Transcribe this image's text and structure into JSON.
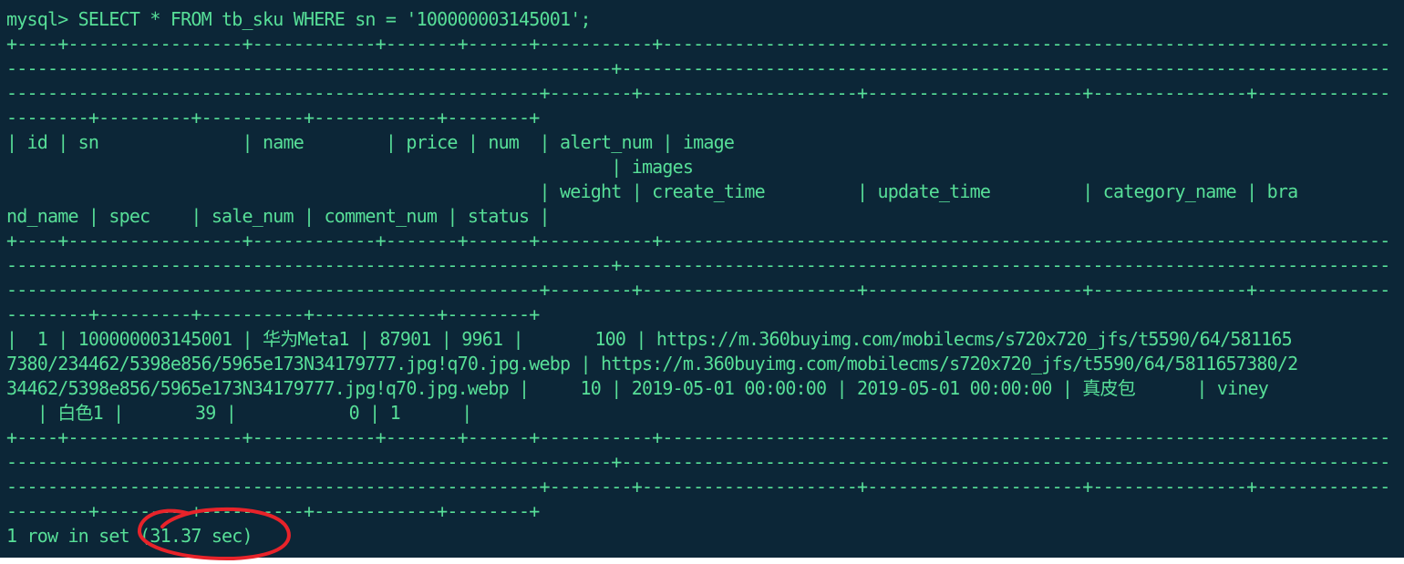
{
  "terminal": {
    "lines": [
      "mysql> SELECT * FROM tb_sku WHERE sn = '100000003145001';",
      "+----+-----------------+------------+-------+------+-----------+----------------------------------------------------------------------------------------------------------------------",
      "-----------------------------------------------------------+-----------------------------------------------------------------------------------------------------------------",
      "----------------------------------------------------+--------+---------------------+---------------------+---------------+---------------------+---",
      "--------+---------+----------+------------+--------+",
      "| id | sn              | name        | price | num  | alert_num | image",
      "                                                           | images",
      "                                                    | weight | create_time         | update_time         | category_name | bra",
      "nd_name | spec    | sale_num | comment_num | status |",
      "+----+-----------------+------------+-------+------+-----------+----------------------------------------------------------------------------------------------------------------------",
      "-----------------------------------------------------------+-----------------------------------------------------------------------------------------------------------------",
      "----------------------------------------------------+--------+---------------------+---------------------+---------------+---------------------+---",
      "--------+---------+----------+------------+--------+",
      "|  1 | 100000003145001 | 华为Meta1 | 87901 | 9961 |       100 | https://m.360buyimg.com/mobilecms/s720x720_jfs/t5590/64/581165",
      "7380/234462/5398e856/5965e173N34179777.jpg!q70.jpg.webp | https://m.360buyimg.com/mobilecms/s720x720_jfs/t5590/64/5811657380/2",
      "34462/5398e856/5965e173N34179777.jpg!q70.jpg.webp |     10 | 2019-05-01 00:00:00 | 2019-05-01 00:00:00 | 真皮包      | viney",
      "   | 白色1 |       39 |           0 | 1      |",
      "+----+-----------------+------------+-------+------+-----------+----------------------------------------------------------------------------------------------------------------------",
      "-----------------------------------------------------------+-----------------------------------------------------------------------------------------------------------------",
      "----------------------------------------------------+--------+---------------------+---------------------+---------------+---------------------+---",
      "--------+---------+----------+------------+--------+",
      "1 row in set (31.37 sec)"
    ]
  },
  "colors": {
    "background": "#0c2637",
    "text": "#57df98",
    "annotation": "#e8232a"
  }
}
